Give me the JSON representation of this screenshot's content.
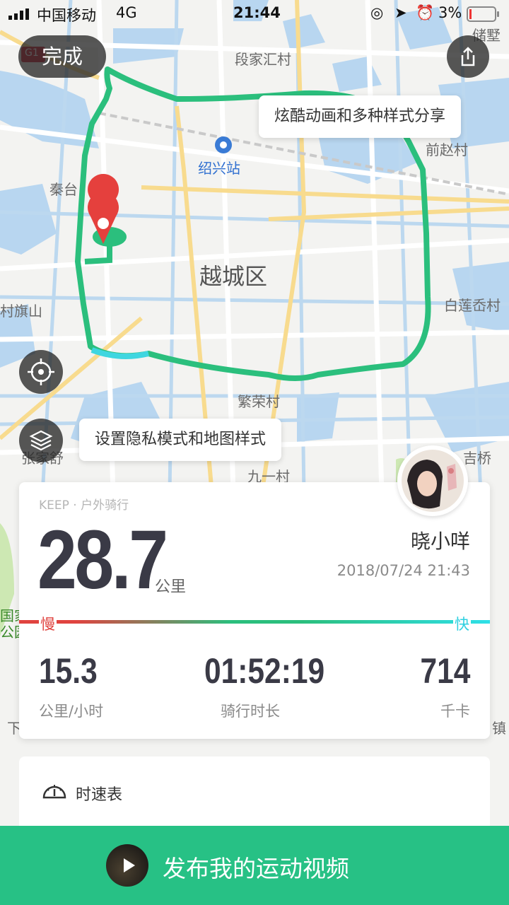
{
  "status_bar": {
    "carrier": "中国移动",
    "network": "4G",
    "time": "21:44",
    "battery": "3%"
  },
  "header": {
    "done_label": "完成",
    "share_icon": "share-icon"
  },
  "map": {
    "labels": {
      "duanjiahuicun": "段家汇村",
      "chuzhu": "储墅",
      "shaoxing_station": "绍兴站",
      "qianzhaocun": "前赵村",
      "qintai": "秦台",
      "yuecheng": "越城区",
      "cunqishan": "村旗山",
      "bailianqiao": "白莲岙村",
      "fanrongcun": "繁荣村",
      "jiuyicun": "九一村",
      "zhangjiaxu": "张家舒",
      "jiqiao": "吉桥",
      "guojia": "国家",
      "gongyuan": "公园",
      "xia": "下",
      "zhen": "镇",
      "g1": "G1"
    },
    "tip_share": "炫酷动画和多种样式分享",
    "tip_privacy": "设置隐私模式和地图样式",
    "locate_icon": "crosshair-icon",
    "layers_icon": "layers-icon"
  },
  "summary": {
    "source": "KEEP · 户外骑行",
    "distance": "28.7",
    "distance_unit": "公里",
    "username": "晓小咩",
    "datetime": "2018/07/24 21:43",
    "slow_label": "慢",
    "fast_label": "快",
    "speed": "15.3",
    "speed_unit": "公里/小时",
    "duration": "01:52:19",
    "duration_label": "骑行时长",
    "calories": "714",
    "calories_unit": "千卡"
  },
  "speedometer": {
    "label": "时速表",
    "icon": "speedometer-icon"
  },
  "publish": {
    "label": "发布我的运动视频",
    "icon": "play-icon"
  },
  "colors": {
    "route": "#2bbf7d",
    "brand_green": "#27c185",
    "slow": "#e0433f",
    "fast": "#2fe0e8"
  }
}
